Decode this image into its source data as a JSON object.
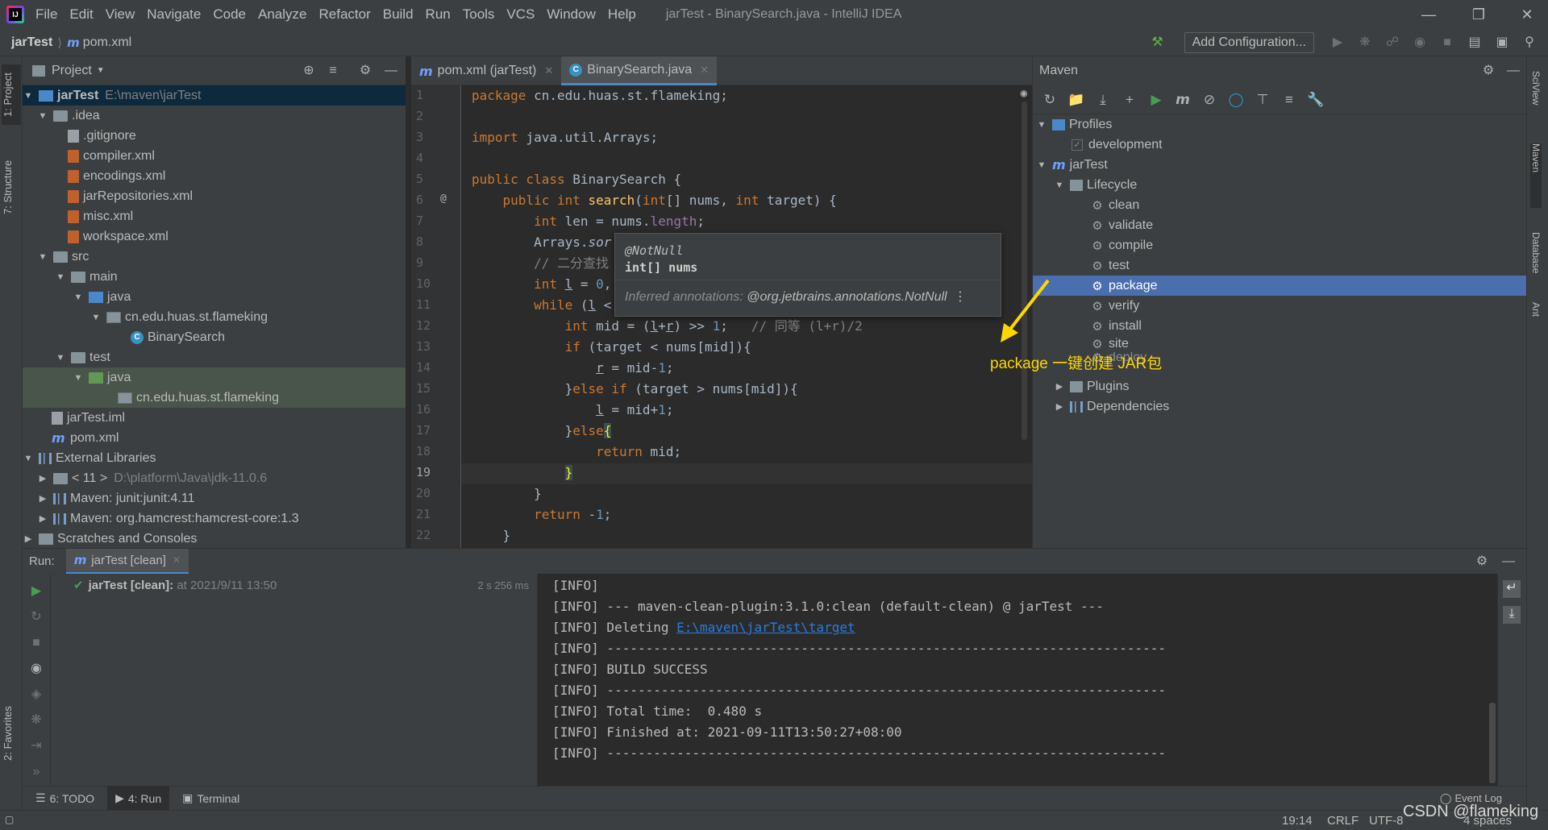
{
  "menubar": {
    "items": [
      "File",
      "Edit",
      "View",
      "Navigate",
      "Code",
      "Analyze",
      "Refactor",
      "Build",
      "Run",
      "Tools",
      "VCS",
      "Window",
      "Help"
    ],
    "title": "jarTest - BinarySearch.java - IntelliJ IDEA"
  },
  "navbar": {
    "project": "jarTest",
    "file": "pom.xml",
    "add_config": "Add Configuration..."
  },
  "left_stripe": {
    "project": "1: Project",
    "structure": "7: Structure",
    "favorites": "2: Favorites"
  },
  "project_panel": {
    "title": "Project",
    "tree": [
      {
        "label": "jarTest",
        "extra": "E:\\maven\\jarTest"
      },
      {
        "label": ".idea"
      },
      {
        "label": ".gitignore"
      },
      {
        "label": "compiler.xml"
      },
      {
        "label": "encodings.xml"
      },
      {
        "label": "jarRepositories.xml"
      },
      {
        "label": "misc.xml"
      },
      {
        "label": "workspace.xml"
      },
      {
        "label": "src"
      },
      {
        "label": "main"
      },
      {
        "label": "java"
      },
      {
        "label": "cn.edu.huas.st.flameking"
      },
      {
        "label": "BinarySearch"
      },
      {
        "label": "test"
      },
      {
        "label": "java"
      },
      {
        "label": "cn.edu.huas.st.flameking"
      },
      {
        "label": "jarTest.iml"
      },
      {
        "label": "pom.xml"
      },
      {
        "label": "External Libraries"
      },
      {
        "label": "< 11 >",
        "extra": "D:\\platform\\Java\\jdk-11.0.6"
      },
      {
        "label": "Maven: junit:junit:4.11"
      },
      {
        "label": "Maven: org.hamcrest:hamcrest-core:1.3"
      },
      {
        "label": "Scratches and Consoles"
      }
    ]
  },
  "editor": {
    "tabs": [
      {
        "label": "pom.xml (jarTest)"
      },
      {
        "label": "BinarySearch.java"
      }
    ],
    "line_numbers": [
      "1",
      "2",
      "3",
      "4",
      "5",
      "6",
      "7",
      "8",
      "9",
      "10",
      "11",
      "12",
      "13",
      "14",
      "15",
      "16",
      "17",
      "18",
      "19",
      "20",
      "21",
      "22"
    ],
    "current_line": "19",
    "tooltip": {
      "annotation": "@NotNull",
      "param": "int[] nums",
      "inferred_label": "Inferred annotations:",
      "inferred_value": "@org.jetbrains.annotations.NotNull"
    }
  },
  "maven_panel": {
    "title": "Maven",
    "tree": {
      "profiles": "Profiles",
      "development": "development",
      "project": "jarTest",
      "lifecycle": "Lifecycle",
      "goals": [
        "clean",
        "validate",
        "compile",
        "test",
        "package",
        "verify",
        "install",
        "site",
        "deploy"
      ],
      "selected_goal": "package",
      "plugins": "Plugins",
      "dependencies": "Dependencies"
    }
  },
  "right_stripe": {
    "sciview": "SciView",
    "maven": "Maven",
    "database": "Database",
    "ant": "Ant"
  },
  "annotation": {
    "text": "package 一键创建 JAR包",
    "color": "#ffd700"
  },
  "run_panel": {
    "label": "Run:",
    "tab": "jarTest [clean]",
    "entry_name": "jarTest [clean]:",
    "entry_time": "at 2021/9/11 13:50",
    "duration": "2 s 256 ms",
    "console": [
      "[INFO]",
      "[INFO] --- maven-clean-plugin:3.1.0:clean (default-clean) @ jarTest ---",
      "[INFO] Deleting ",
      "[INFO] ------------------------------------------------------------------------",
      "[INFO] BUILD SUCCESS",
      "[INFO] ------------------------------------------------------------------------",
      "[INFO] Total time:  0.480 s",
      "[INFO] Finished at: 2021-09-11T13:50:27+08:00",
      "[INFO] ------------------------------------------------------------------------"
    ],
    "deleting_link": "E:\\maven\\jarTest\\target"
  },
  "bottom_tools": {
    "todo": "6: TODO",
    "run": "4: Run",
    "terminal": "Terminal",
    "event_log": "Event Log"
  },
  "statusbar": {
    "position": "19:14",
    "line_sep": "CRLF",
    "encoding": "UTF-8",
    "indent": "4 spaces"
  },
  "watermark": "CSDN @flameking"
}
